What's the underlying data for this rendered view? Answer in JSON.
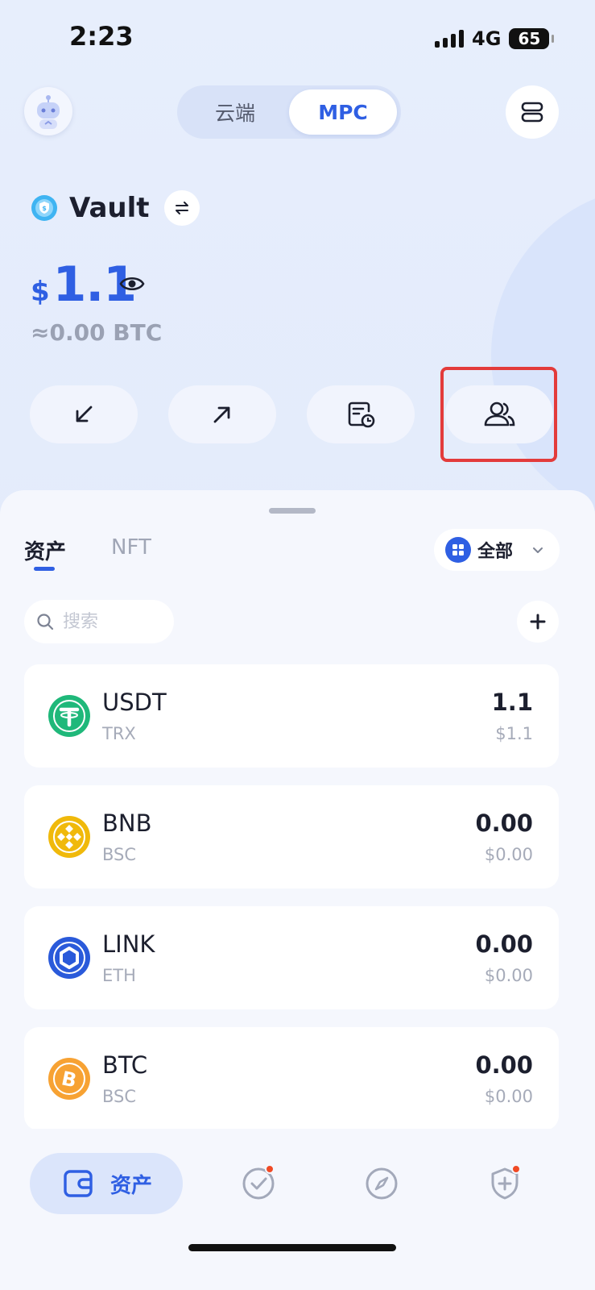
{
  "status_bar": {
    "time": "2:23",
    "network": "4G",
    "battery": "65"
  },
  "header": {
    "segments": [
      "云端",
      "MPC"
    ],
    "active_segment": "MPC"
  },
  "wallet": {
    "name": "Vault",
    "currency_symbol": "$",
    "balance": "1.1",
    "btc_equivalent": "≈0.00 BTC"
  },
  "actions": [
    {
      "icon": "receive-arrow-icon"
    },
    {
      "icon": "send-arrow-icon"
    },
    {
      "icon": "history-icon"
    },
    {
      "icon": "members-icon"
    }
  ],
  "tabs": {
    "assets": "资产",
    "nft": "NFT"
  },
  "filter": {
    "label": "全部"
  },
  "search": {
    "placeholder": "搜索"
  },
  "assets": [
    {
      "symbol": "USDT",
      "chain": "TRX",
      "amount": "1.1",
      "usd": "$1.1",
      "color": "#1fb87a"
    },
    {
      "symbol": "BNB",
      "chain": "BSC",
      "amount": "0.00",
      "usd": "$0.00",
      "color": "#f0b90b"
    },
    {
      "symbol": "LINK",
      "chain": "ETH",
      "amount": "0.00",
      "usd": "$0.00",
      "color": "#2a5ada"
    },
    {
      "symbol": "BTC",
      "chain": "BSC",
      "amount": "0.00",
      "usd": "$0.00",
      "color": "#f7a233"
    }
  ],
  "bottom_nav": {
    "active_label": "资产"
  },
  "colors": {
    "accent": "#2f5fe3",
    "highlight": "#e33b3b",
    "badge": "#f04a25"
  }
}
